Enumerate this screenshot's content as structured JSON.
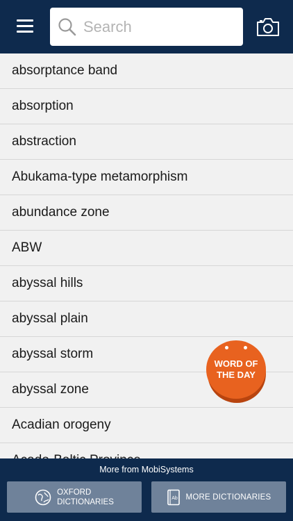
{
  "header": {
    "search_placeholder": "Search",
    "menu_icon": "hamburger-menu-icon",
    "search_icon": "magnifier-icon",
    "camera_icon": "camera-icon",
    "bar_color": "#0e2a4d"
  },
  "word_list": {
    "items": [
      "absorptance band",
      "absorption",
      "abstraction",
      "Abukama-type metamorphism",
      "abundance zone",
      "ABW",
      "abyssal hills",
      "abyssal plain",
      "abyssal storm",
      "abyssal zone",
      "Acadian orogeny",
      "Acado-Baltic Province"
    ]
  },
  "word_of_the_day": {
    "line1": "WORD OF",
    "line2": "THE DAY",
    "color": "#e8621f"
  },
  "footer": {
    "caption": "More from MobiSystems",
    "oxford_line1": "OXFORD",
    "oxford_line2": "DICTIONARIES",
    "more_label": "MORE DICTIONARIES",
    "oxford_icon": "globe-icon",
    "more_icon": "dictionary-book-icon",
    "button_color": "#6f829a"
  }
}
